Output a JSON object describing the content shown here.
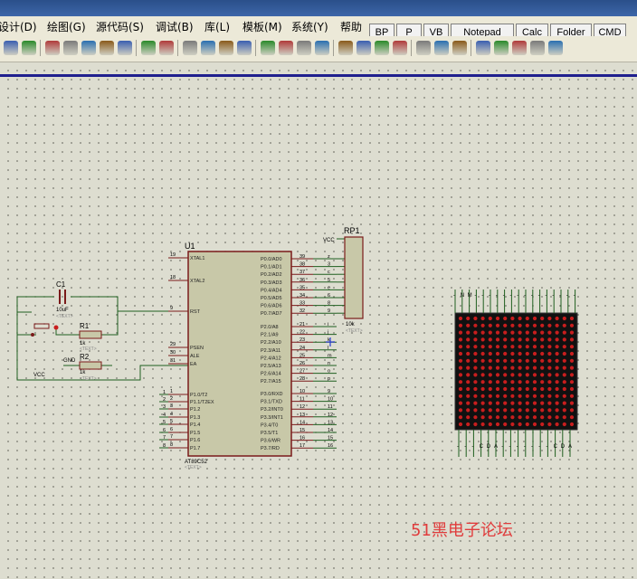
{
  "menu": {
    "items": [
      "设计(D)",
      "绘图(G)",
      "源代码(S)",
      "调试(B)",
      "库(L)",
      "模板(M)",
      "系统(Y)",
      "帮助"
    ]
  },
  "quick_launch": {
    "buttons": [
      "BP",
      "P",
      "VB",
      "Notepad",
      "Calc",
      "Folder",
      "CMD"
    ]
  },
  "toolbar": {
    "icons": [
      "grid-icon",
      "origin-icon",
      "pan-icon",
      "zoom-in-icon",
      "zoom-out-icon",
      "zoom-all-icon",
      "zoom-area-icon",
      "undo-icon",
      "redo-icon",
      "cut-icon",
      "copy-icon",
      "paste-icon",
      "block-copy-icon",
      "block-move-icon",
      "block-rotate-icon",
      "block-delete-icon",
      "pick-device-icon",
      "make-device-icon",
      "packaging-icon",
      "decompose-icon",
      "wire-autorouter-icon",
      "search-icon",
      "property-assign-icon",
      "design-explorer-icon",
      "new-sheet-icon",
      "delete-sheet-icon",
      "netlist-icon",
      "bill-of-materials-icon",
      "electrical-check-icon"
    ]
  },
  "schematic": {
    "mcu": {
      "ref": "U1",
      "part": "AT89C52",
      "text_tag": "<TEXT>",
      "left_pins": [
        {
          "num": "19",
          "name": "XTAL1"
        },
        {
          "num": "18",
          "name": "XTAL2"
        },
        {
          "num": "9",
          "name": "RST"
        },
        {
          "num": "29",
          "name": "PSEN"
        },
        {
          "num": "30",
          "name": "ALE"
        },
        {
          "num": "31",
          "name": "EA"
        },
        {
          "num": "1",
          "name": "P1.0/T2"
        },
        {
          "num": "2",
          "name": "P1.1/T2EX"
        },
        {
          "num": "3",
          "name": "P1.2"
        },
        {
          "num": "4",
          "name": "P1.3"
        },
        {
          "num": "5",
          "name": "P1.4"
        },
        {
          "num": "6",
          "name": "P1.5"
        },
        {
          "num": "7",
          "name": "P1.6"
        },
        {
          "num": "8",
          "name": "P1.7"
        }
      ],
      "p1_net_labels": [
        "1",
        "2",
        "3",
        "4",
        "5",
        "6",
        "7",
        "8"
      ],
      "right_pins": [
        {
          "num": "39",
          "name": "P0.0/AD0",
          "net": "z"
        },
        {
          "num": "38",
          "name": "P0.1/AD1",
          "net": "3"
        },
        {
          "num": "37",
          "name": "P0.2/AD2",
          "net": "c"
        },
        {
          "num": "36",
          "name": "P0.3/AD3",
          "net": "5"
        },
        {
          "num": "35",
          "name": "P0.4/AD4",
          "net": "e"
        },
        {
          "num": "34",
          "name": "P0.5/AD5",
          "net": "6"
        },
        {
          "num": "33",
          "name": "P0.6/AD6",
          "net": "8"
        },
        {
          "num": "32",
          "name": "P0.7/AD7",
          "net": "9"
        },
        {
          "num": "21",
          "name": "P2.0/A8",
          "net": "i"
        },
        {
          "num": "22",
          "name": "P2.1/A9",
          "net": "j"
        },
        {
          "num": "23",
          "name": "P2.2/A10",
          "net": "k"
        },
        {
          "num": "24",
          "name": "P2.3/A11",
          "net": "l"
        },
        {
          "num": "25",
          "name": "P2.4/A12",
          "net": "m"
        },
        {
          "num": "26",
          "name": "P2.5/A13",
          "net": "n"
        },
        {
          "num": "27",
          "name": "P2.6/A14",
          "net": "o"
        },
        {
          "num": "28",
          "name": "P2.7/A15",
          "net": "p"
        },
        {
          "num": "10",
          "name": "P3.0/RXD",
          "net": "9"
        },
        {
          "num": "11",
          "name": "P3.1/TXD",
          "net": "10"
        },
        {
          "num": "12",
          "name": "P3.2/INT0",
          "net": "11"
        },
        {
          "num": "13",
          "name": "P3.3/INT1",
          "net": "12"
        },
        {
          "num": "14",
          "name": "P3.4/T0",
          "net": "13"
        },
        {
          "num": "15",
          "name": "P3.5/T1",
          "net": "14"
        },
        {
          "num": "16",
          "name": "P3.6/WR",
          "net": "15"
        },
        {
          "num": "17",
          "name": "P3.7/RD",
          "net": "16"
        }
      ]
    },
    "rp1": {
      "ref": "RP1",
      "value": "10k",
      "text_tag": "<TEXT>",
      "vcc_label": "VCC",
      "pin1": "1"
    },
    "c1": {
      "ref": "C1",
      "value": "10uF",
      "text_tag": "<TEXT>"
    },
    "r1": {
      "ref": "R1",
      "value": "1k",
      "text_tag": "<TEXT>"
    },
    "r2": {
      "ref": "R2",
      "value": "1k",
      "text_tag": "<TEXT>",
      "gnd_label": "GND"
    },
    "vcc_label": "VCC",
    "matrix": {
      "rows": 16,
      "cols": 16,
      "led_color": "#c81e1e",
      "body_color": "#111111",
      "top_pin_labels": [
        "-",
        "N",
        "M",
        "-",
        "-",
        "-",
        "-",
        "-",
        "-",
        "-",
        "-",
        "-",
        "-",
        "-",
        "-",
        "-",
        "-",
        "-"
      ],
      "bottom_pin_labels": [
        "-",
        "-",
        "-",
        "C",
        "D",
        "A",
        "-",
        "-",
        "-",
        "-",
        "-",
        "-",
        "-",
        "C",
        "D",
        "A"
      ]
    }
  },
  "watermark": "51黑电子论坛",
  "colors": {
    "wire": "#1f5f1f",
    "chip_body": "#c8c8a8",
    "chip_outline": "#7a1a1a",
    "pin_line": "#7a1a1a",
    "canvas_border": "#1f1f8e"
  }
}
